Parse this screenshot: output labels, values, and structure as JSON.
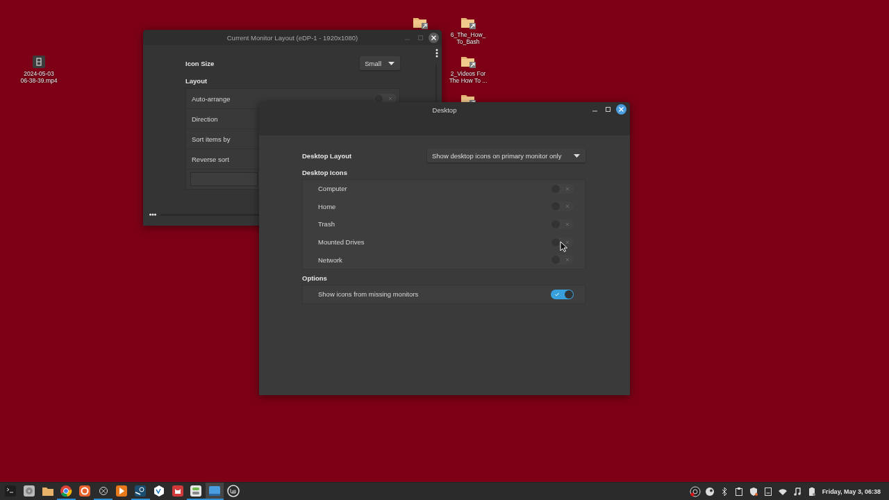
{
  "desktop_icons": [
    {
      "kind": "video",
      "lines": [
        "2024-05-03",
        "06-38-39.mp4"
      ]
    },
    {
      "kind": "folder"
    },
    {
      "kind": "folder",
      "lines": [
        "6_The_How_",
        "To_Bash"
      ]
    },
    {
      "kind": "folder",
      "lines": [
        "2_Videos For",
        "The How To ..."
      ]
    },
    {
      "kind": "folder"
    }
  ],
  "back_window": {
    "title": "Current Monitor Layout (eDP-1 - 1920x1080)",
    "icon_size": {
      "label": "Icon Size",
      "value": "Small"
    },
    "layout_heading": "Layout",
    "rows": [
      {
        "kind": "toggle",
        "label": "Auto-arrange",
        "on": false
      },
      {
        "kind": "plain",
        "label": "Direction"
      },
      {
        "kind": "plain",
        "label": "Sort items by"
      },
      {
        "kind": "plain",
        "label": "Reverse sort"
      },
      {
        "kind": "button"
      }
    ]
  },
  "window": {
    "title": "Desktop",
    "layout": {
      "label": "Desktop Layout",
      "value": "Show desktop icons on primary monitor only"
    },
    "sections": [
      {
        "heading": "Desktop Icons",
        "rows": [
          {
            "label": "Computer",
            "on": false
          },
          {
            "label": "Home",
            "on": false
          },
          {
            "label": "Trash",
            "on": false
          },
          {
            "label": "Mounted Drives",
            "on": false
          },
          {
            "label": "Network",
            "on": false
          }
        ]
      },
      {
        "heading": "Options",
        "rows": [
          {
            "label": "Show icons from missing monitors",
            "on": true
          }
        ]
      }
    ]
  },
  "taskbar": {
    "launchers": [
      {
        "kind": "terminal",
        "running": false,
        "selected": false
      },
      {
        "kind": "disk",
        "running": false,
        "selected": false
      },
      {
        "kind": "folder",
        "running": false,
        "selected": false
      },
      {
        "kind": "browser",
        "running": true,
        "selected": false
      },
      {
        "kind": "fox",
        "running": false,
        "selected": false
      },
      {
        "kind": "aperture",
        "running": true,
        "selected": false
      },
      {
        "kind": "play",
        "running": false,
        "selected": false
      },
      {
        "kind": "steam",
        "running": true,
        "selected": false
      },
      {
        "kind": "vc",
        "running": false,
        "selected": false
      },
      {
        "kind": "cat",
        "running": false,
        "selected": false
      },
      {
        "kind": "settings",
        "running": true,
        "selected": false
      },
      {
        "kind": "window",
        "running": true,
        "selected": true
      },
      {
        "kind": "mint",
        "running": false,
        "selected": false
      }
    ],
    "tray": [
      {
        "kind": "obs"
      },
      {
        "kind": "steam"
      },
      {
        "kind": "bluetooth"
      },
      {
        "kind": "clipboard"
      },
      {
        "kind": "shield"
      },
      {
        "kind": "note"
      },
      {
        "kind": "wifi"
      },
      {
        "kind": "music"
      },
      {
        "kind": "battery"
      }
    ],
    "clock": "Friday, May 3, 06:38"
  }
}
